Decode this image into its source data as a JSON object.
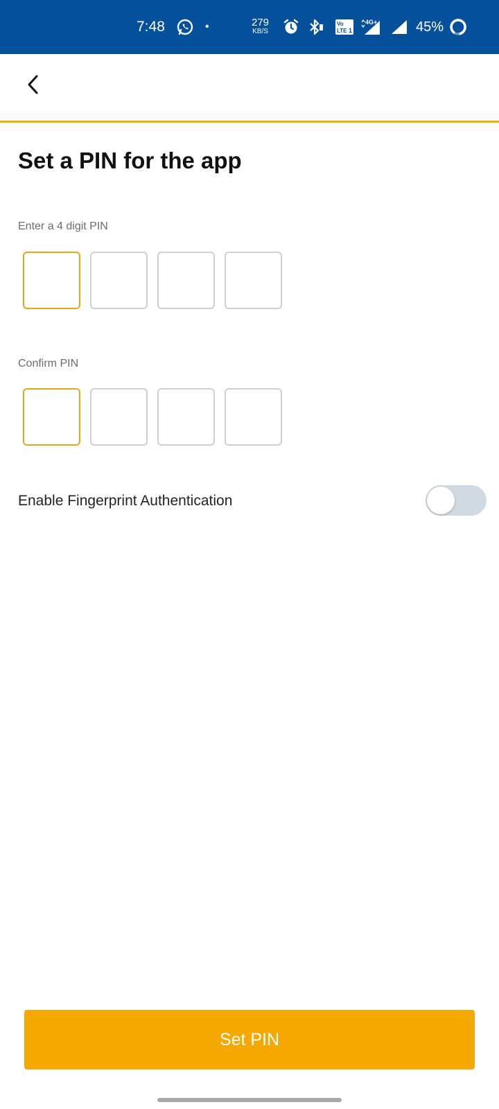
{
  "status_bar": {
    "time": "7:48",
    "dot": "•",
    "net_speed_value": "279",
    "net_speed_unit": "KB/S",
    "volte": "Vo LTE 1",
    "network_type": "4G+",
    "battery_percent": "45%",
    "background_color": "#04509a",
    "icons": [
      "whatsapp-icon",
      "alarm-icon",
      "bluetooth-icon",
      "volte-icon",
      "signal-icon",
      "battery-icon"
    ]
  },
  "header": {
    "back_icon": "chevron-left-icon",
    "accent_color": "#f0ac07"
  },
  "main": {
    "title": "Set a PIN for the app",
    "pin_label": "Enter a 4 digit PIN",
    "confirm_label": "Confirm PIN",
    "pin_digits": [
      "",
      "",
      "",
      ""
    ],
    "confirm_digits": [
      "",
      "",
      "",
      ""
    ],
    "fingerprint_label": "Enable Fingerprint Authentication",
    "fingerprint_enabled": false
  },
  "footer": {
    "set_pin_label": "Set PIN",
    "button_color": "#f5a800"
  }
}
